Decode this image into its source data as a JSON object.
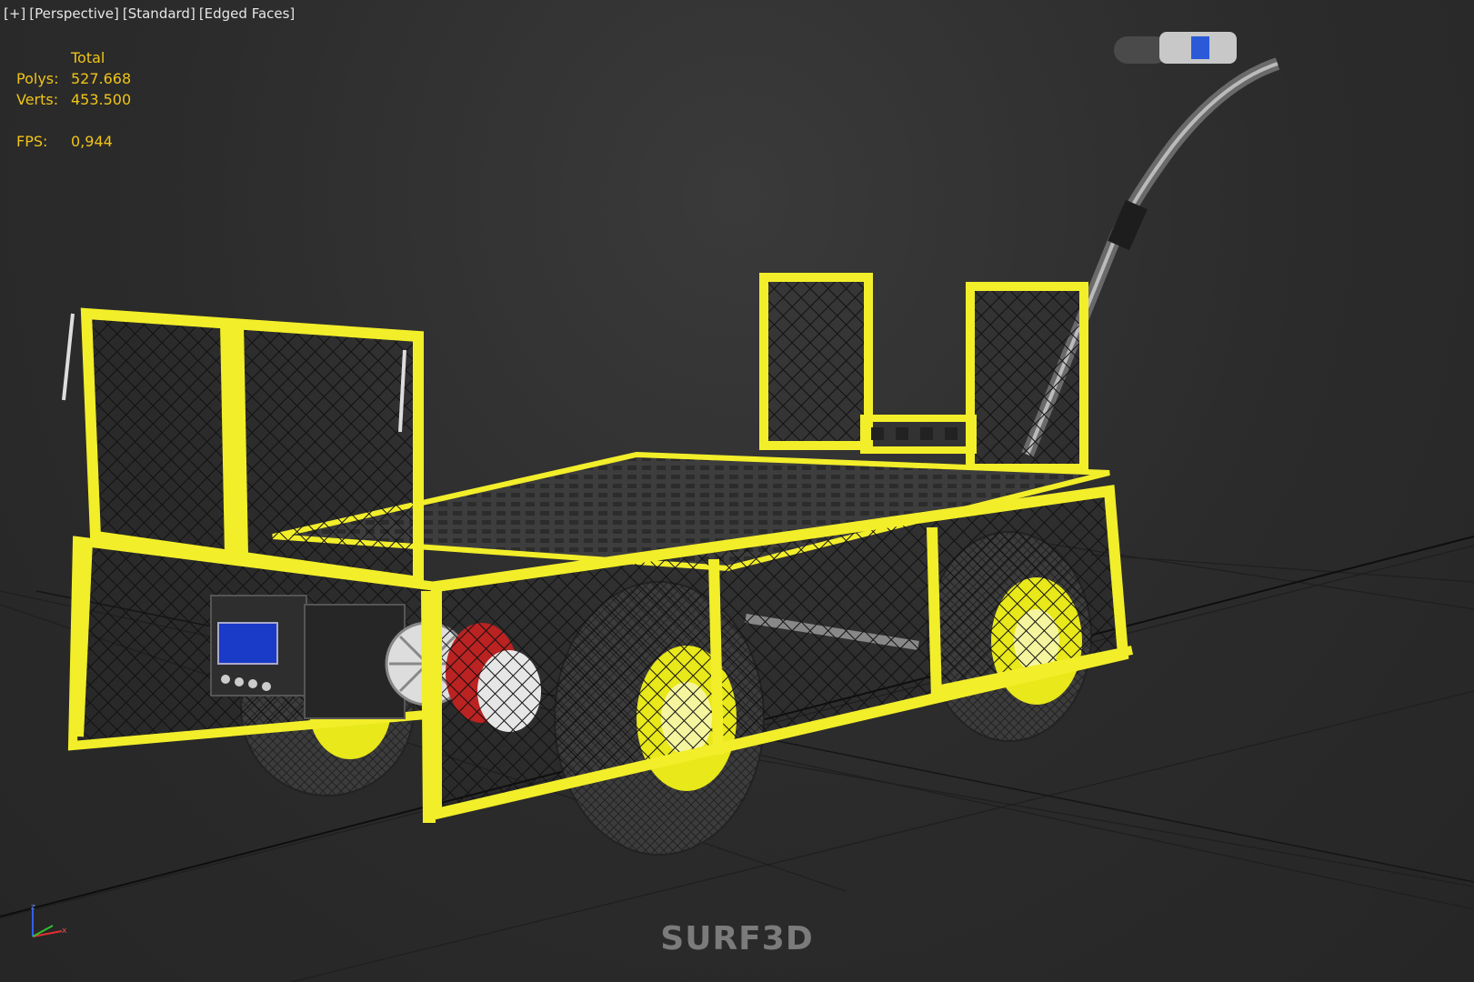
{
  "viewport_label": {
    "items": [
      "[+]",
      "[Perspective]",
      "[Standard]",
      "[Edged Faces]"
    ]
  },
  "stats": {
    "header": "Total",
    "polys_label": "Polys:",
    "polys_value": "527.668",
    "verts_label": "Verts:",
    "verts_value": "453.500",
    "fps_label": "FPS:",
    "fps_value": "0,944"
  },
  "watermark": "SURF3D",
  "axis": {
    "z": "z",
    "x": "x"
  },
  "colors": {
    "selection": "#f2ee2a",
    "stats_text": "#f0c419",
    "background": "#2b2b2b",
    "display_panel": "#1a3ac8"
  }
}
